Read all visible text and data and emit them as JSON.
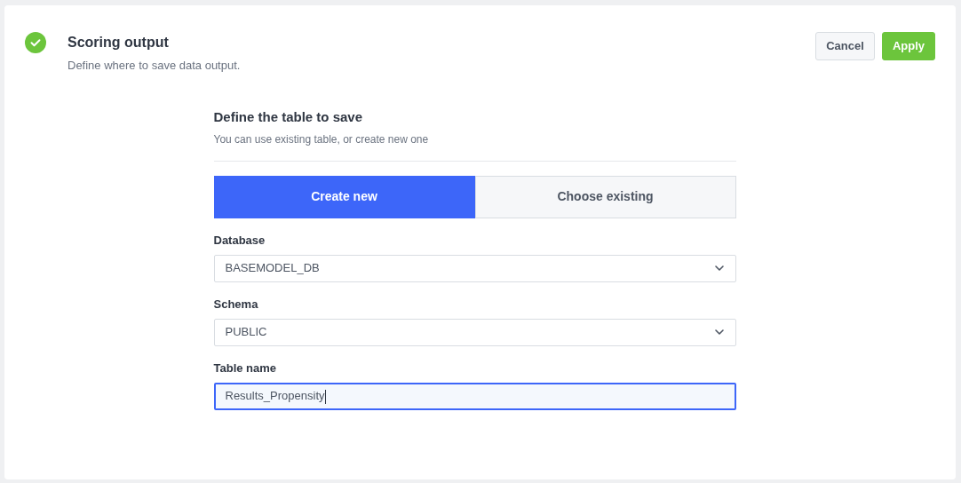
{
  "header": {
    "title": "Scoring output",
    "subtitle": "Define where to save data output.",
    "completed": true
  },
  "actions": [
    {
      "label": "Cancel",
      "kind": "secondary"
    },
    {
      "label": "Apply",
      "kind": "primary"
    }
  ],
  "form": {
    "title": "Define the table to save",
    "subtitle": "You can use existing table, or create new one",
    "modes": [
      {
        "label": "Create new",
        "selected": true
      },
      {
        "label": "Choose existing",
        "selected": false
      }
    ],
    "fields": [
      {
        "label": "Database",
        "kind": "select",
        "value": "BASEMODEL_DB",
        "focused": false
      },
      {
        "label": "Schema",
        "kind": "select",
        "value": "PUBLIC",
        "focused": false
      },
      {
        "label": "Table name",
        "kind": "text",
        "value": "Results_Propensity",
        "focused": true
      }
    ]
  }
}
